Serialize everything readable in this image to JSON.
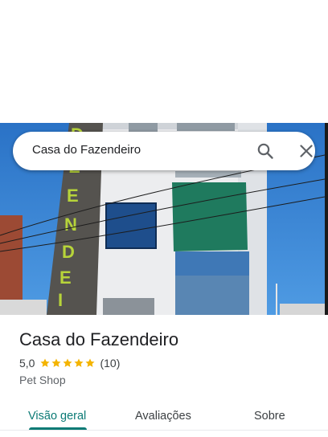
{
  "search": {
    "query": "Casa do Fazendeiro"
  },
  "photo": {
    "description_icon": "storefront-photo",
    "facade_lettering": "FAZENDEIRO"
  },
  "place": {
    "name": "Casa do Fazendeiro",
    "rating": "5,0",
    "stars": 5,
    "review_count": "(10)",
    "category": "Pet Shop"
  },
  "tabs": [
    {
      "label": "Visão geral",
      "active": true
    },
    {
      "label": "Avaliações",
      "active": false
    },
    {
      "label": "Sobre",
      "active": false
    }
  ],
  "colors": {
    "accent": "#0b7a75",
    "star": "#f4b400",
    "sky": "#2f7fd1"
  }
}
